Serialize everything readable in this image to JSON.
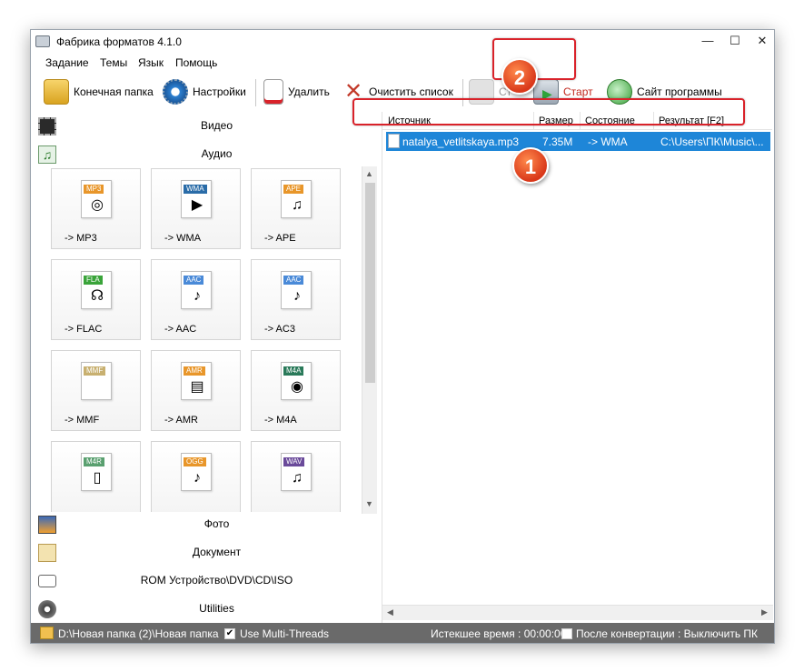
{
  "window": {
    "title": "Фабрика форматов 4.1.0",
    "min": "—",
    "max": "☐",
    "close": "✕"
  },
  "menu": [
    "Задание",
    "Темы",
    "Язык",
    "Помощь"
  ],
  "toolbar": {
    "output_folder": "Конечная папка",
    "settings": "Настройки",
    "delete": "Удалить",
    "clear_list": "Очистить список",
    "stop": "Ст",
    "start": "Старт",
    "website": "Сайт программы"
  },
  "categories": {
    "video": "Видео",
    "audio": "Аудио",
    "photo": "Фото",
    "document": "Документ",
    "rom": "ROM Устройство\\DVD\\CD\\ISO",
    "utilities": "Utilities"
  },
  "audio_formats": [
    {
      "tag": "MP3",
      "label": "-> MP3",
      "tag_color": "#e8962a",
      "glyph": "◎"
    },
    {
      "tag": "WMA",
      "label": "-> WMA",
      "tag_color": "#2a6ca8",
      "glyph": "▶"
    },
    {
      "tag": "APE",
      "label": "-> APE",
      "tag_color": "#e8962a",
      "glyph": "♫"
    },
    {
      "tag": "FLA",
      "label": "-> FLAC",
      "tag_color": "#3aa43a",
      "glyph": "☊"
    },
    {
      "tag": "AAC",
      "label": "-> AAC",
      "tag_color": "#4a8ad8",
      "glyph": "♪"
    },
    {
      "tag": "AAC",
      "label": "-> AC3",
      "tag_color": "#4a8ad8",
      "glyph": "♪"
    },
    {
      "tag": "MMF",
      "label": "-> MMF",
      "tag_color": "#c8b070",
      "glyph": ""
    },
    {
      "tag": "AMR",
      "label": "-> AMR",
      "tag_color": "#e8962a",
      "glyph": "▤"
    },
    {
      "tag": "M4A",
      "label": "-> M4A",
      "tag_color": "#2a7a5a",
      "glyph": "◉"
    },
    {
      "tag": "M4R",
      "label": "",
      "tag_color": "#5aa070",
      "glyph": "▯"
    },
    {
      "tag": "OGG",
      "label": "",
      "tag_color": "#e8962a",
      "glyph": "♪"
    },
    {
      "tag": "WAV",
      "label": "",
      "tag_color": "#6a4a9a",
      "glyph": "♫"
    }
  ],
  "file_list": {
    "columns": [
      "Источник",
      "Размер",
      "Состояние",
      "Результат [F2]"
    ],
    "rows": [
      {
        "source": "natalya_vetlitskaya.mp3",
        "size": "7.35M",
        "state": "-> WMA",
        "result": "C:\\Users\\ПК\\Music\\..."
      }
    ]
  },
  "annotations": {
    "badge1": "1",
    "badge2": "2",
    "color": "#d9222a"
  },
  "status": {
    "path": "D:\\Новая папка (2)\\Новая папка",
    "multithreads": "Use Multi-Threads",
    "multithreads_checked": "✔",
    "elapsed": "Истекшее время : 00:00:00",
    "after_convert": "После конвертации : Выключить ПК"
  }
}
